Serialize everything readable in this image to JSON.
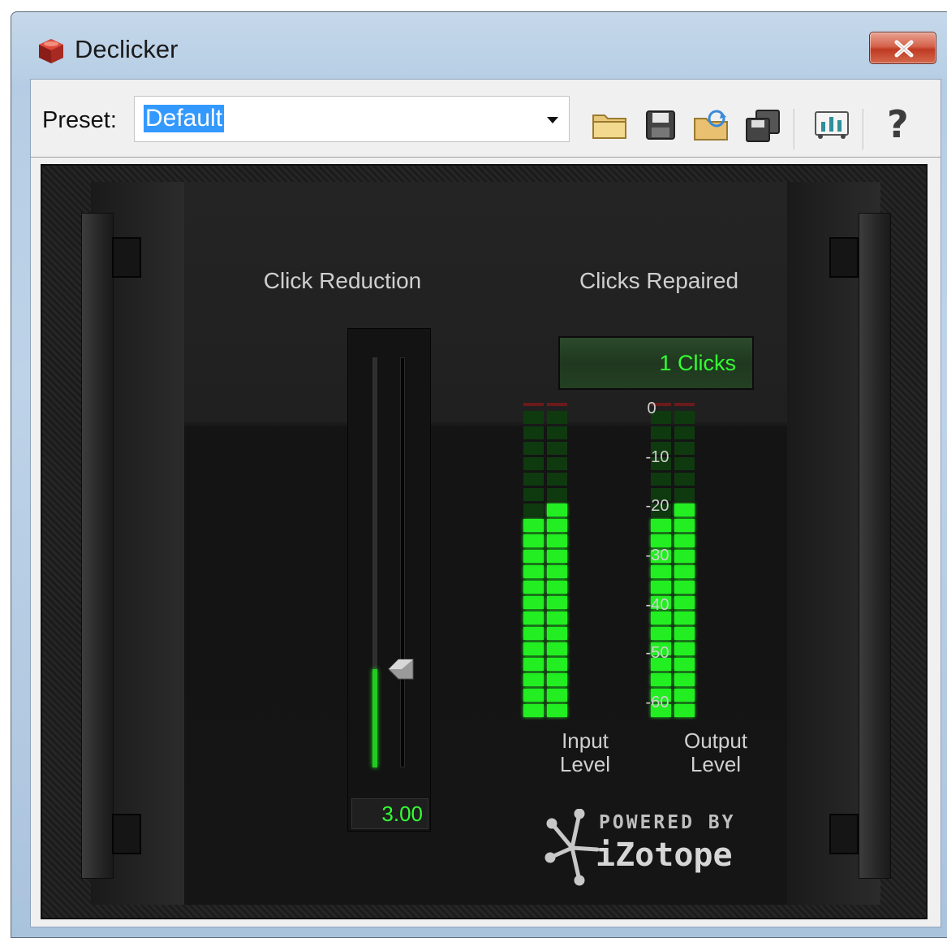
{
  "window": {
    "title": "Declicker",
    "close_glyph": "close-icon"
  },
  "toolbar": {
    "preset_label": "Preset:",
    "preset_value": "Default",
    "icons": [
      "dropdown-arrow-icon",
      "open-folder-icon",
      "save-icon",
      "load-folder-icon",
      "copy-icon",
      "meter-view-icon",
      "help-icon"
    ],
    "help_label": "?"
  },
  "plugin": {
    "click_reduction": {
      "title": "Click Reduction",
      "value": "3.00",
      "slider_fraction": 0.24
    },
    "clicks_repaired": {
      "title": "Clicks Repaired",
      "value": "1 Clicks"
    },
    "meters": {
      "scale": [
        "0",
        "-10",
        "-20",
        "-30",
        "-40",
        "-50",
        "-60"
      ],
      "input_label_line1": "Input",
      "input_label_line2": "Level",
      "output_label_line1": "Output",
      "output_label_line2": "Level",
      "input_level_db": [
        -20,
        -17
      ],
      "output_level_db": [
        -20,
        -17
      ],
      "segments": 20,
      "active_color": "#22ee22",
      "inactive_color": "#0f3a0f",
      "peak_color": "#6a1a1a"
    },
    "logo": {
      "line1": "POWERED BY",
      "line2": "iZotope"
    }
  },
  "colors": {
    "accent_green": "#33ff33",
    "close_red": "#c9452c",
    "selection_blue": "#3399ff"
  }
}
